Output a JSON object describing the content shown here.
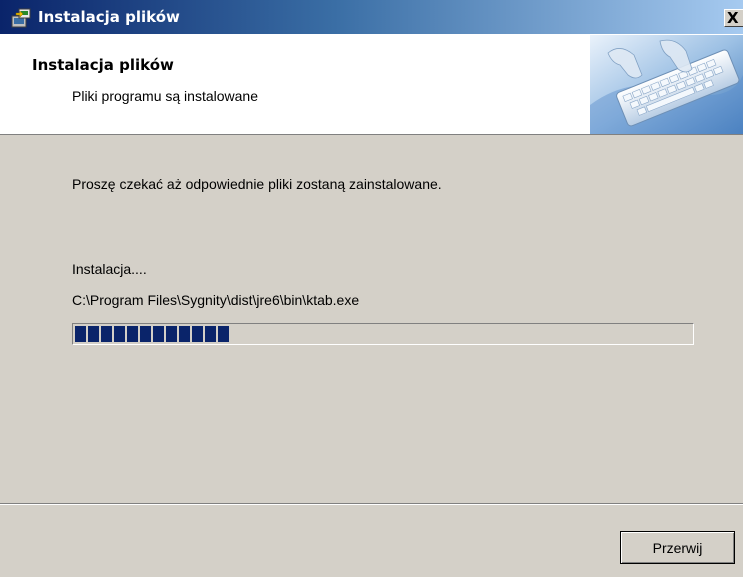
{
  "window": {
    "title": "Instalacja plików",
    "close_symbol": "X",
    "icon": "installer-icon"
  },
  "header": {
    "title": "Instalacja plików",
    "subtitle": "Pliki programu są instalowane",
    "image": "keyboard-typing-image"
  },
  "body": {
    "info": "Proszę czekać aż odpowiednie pliki zostaną zainstalowane.",
    "status": "Instalacja....",
    "current_file": "C:\\Program Files\\Sygnity\\dist\\jre6\\bin\\ktab.exe",
    "progress_fraction": 0.26
  },
  "buttons": {
    "cancel_label": "Przerwij"
  },
  "colors": {
    "title_bar_start": "#0a246a",
    "title_bar_end": "#a6caf0",
    "progress_fill": "#0a246a",
    "dialog_face": "#d4d0c8"
  }
}
